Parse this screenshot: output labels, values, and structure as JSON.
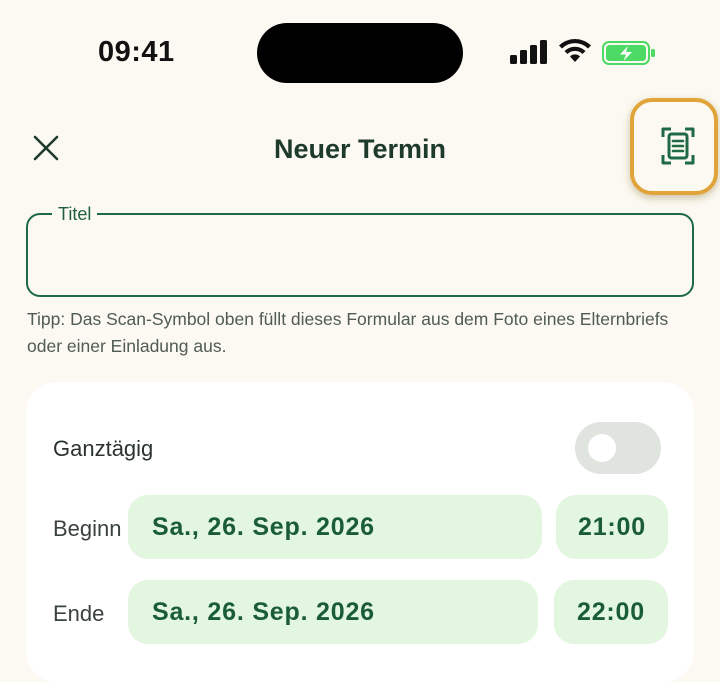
{
  "status_bar": {
    "time": "09:41",
    "icons": [
      "cellular-signal-icon",
      "wifi-icon",
      "battery-charging-icon"
    ],
    "battery_color": "#4cd964"
  },
  "nav": {
    "close_icon": "close-icon",
    "title": "Neuer Termin",
    "scan_icon": "document-scan-icon"
  },
  "form": {
    "title_label": "Titel",
    "title_value": "",
    "tip": "Tipp: Das Scan-Symbol oben füllt dieses Formular aus dem Foto eines Elternbriefs oder einer Einladung aus."
  },
  "schedule": {
    "allday_label": "Ganztägig",
    "allday_on": false,
    "start": {
      "label": "Beginn",
      "date": "Sa., 26. Sep. 2026",
      "time": "21:00"
    },
    "end": {
      "label": "Ende",
      "date": "Sa., 26. Sep. 2026",
      "time": "22:00"
    }
  },
  "colors": {
    "accent": "#1f6a45",
    "highlight": "#e0a43a",
    "pill_bg": "#e3f6df",
    "background": "#fbf9f1"
  }
}
